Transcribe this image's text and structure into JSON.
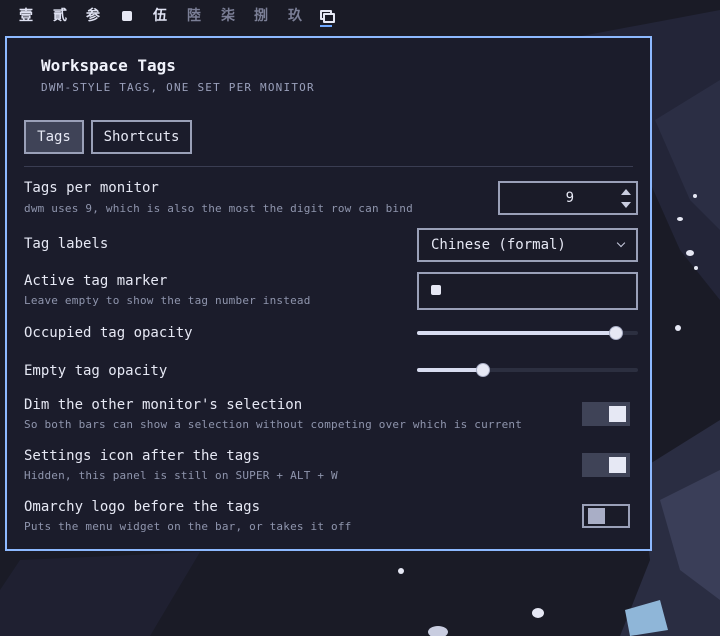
{
  "topbar": {
    "tags": [
      {
        "label": "壹",
        "state": "occupied"
      },
      {
        "label": "貳",
        "state": "occupied"
      },
      {
        "label": "参",
        "state": "occupied"
      },
      {
        "label": "",
        "state": "active"
      },
      {
        "label": "伍",
        "state": "occupied"
      },
      {
        "label": "陸",
        "state": "empty"
      },
      {
        "label": "柒",
        "state": "empty"
      },
      {
        "label": "捌",
        "state": "empty"
      },
      {
        "label": "玖",
        "state": "empty"
      }
    ],
    "settings_icon": "settings-windows-icon"
  },
  "panel": {
    "title": "Workspace Tags",
    "subtitle": "DWM-STYLE TAGS, ONE SET PER MONITOR",
    "tabs": [
      {
        "label": "Tags",
        "active": true
      },
      {
        "label": "Shortcuts",
        "active": false
      }
    ],
    "tags_per_monitor": {
      "label": "Tags per monitor",
      "hint": "dwm uses 9, which is also the most the digit row can bind",
      "value": "9"
    },
    "tag_labels": {
      "label": "Tag labels",
      "value": "Chinese (formal)"
    },
    "active_marker": {
      "label": "Active tag marker",
      "hint": "Leave empty to show the tag number instead",
      "value_icon": "small-square"
    },
    "occupied_opacity": {
      "label": "Occupied tag opacity",
      "value": 0.9
    },
    "empty_opacity": {
      "label": "Empty tag opacity",
      "value": 0.3
    },
    "dim_selection": {
      "label": "Dim the other monitor's selection",
      "hint": "So both bars can show a selection without competing over which is current",
      "on": true
    },
    "settings_icon_after": {
      "label": "Settings icon after the tags",
      "hint": "Hidden, this panel is still on SUPER + ALT + W",
      "on": true
    },
    "omarchy_logo": {
      "label": "Omarchy logo before the tags",
      "hint": "Puts the menu widget on the bar, or takes it off",
      "on": false
    }
  },
  "colors": {
    "background": "#1a1b26",
    "panel_border": "#8db9ff",
    "accent_underline": "#6fa8ff"
  }
}
